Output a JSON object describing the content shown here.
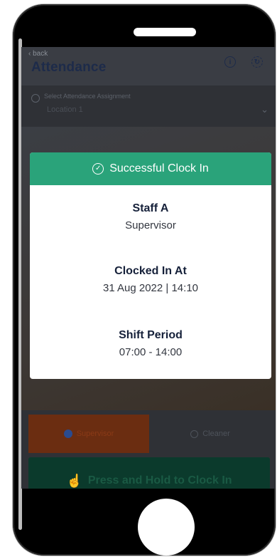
{
  "header": {
    "back_label": "back",
    "title": "Attendance"
  },
  "assignment": {
    "label": "Select Attendance Assignment",
    "value": "Location 1"
  },
  "roles": {
    "supervisor_label": "Supervisor",
    "cleaner_label": "Cleaner",
    "selected": "Supervisor"
  },
  "clock_in_button": "Press and Hold to Clock In",
  "modal": {
    "title": "Successful Clock In",
    "staff_name": "Staff A",
    "staff_role": "Supervisor",
    "clocked_in_label": "Clocked In At",
    "clocked_in_value": "31 Aug 2022 | 14:10",
    "shift_label": "Shift Period",
    "shift_value": "07:00 - 14:00"
  },
  "icons": {
    "back": "chevron-left-icon",
    "info": "info-icon",
    "history": "history-icon",
    "location": "location-pin-icon",
    "dropdown": "chevron-down-icon",
    "success": "check-circle-icon",
    "hand": "hand-tap-icon"
  },
  "colors": {
    "success_green": "#2aa37a",
    "supervisor_orange": "#6b2d11",
    "clockin_green": "#0b3a2c",
    "title_navy": "#1d2b4a"
  }
}
